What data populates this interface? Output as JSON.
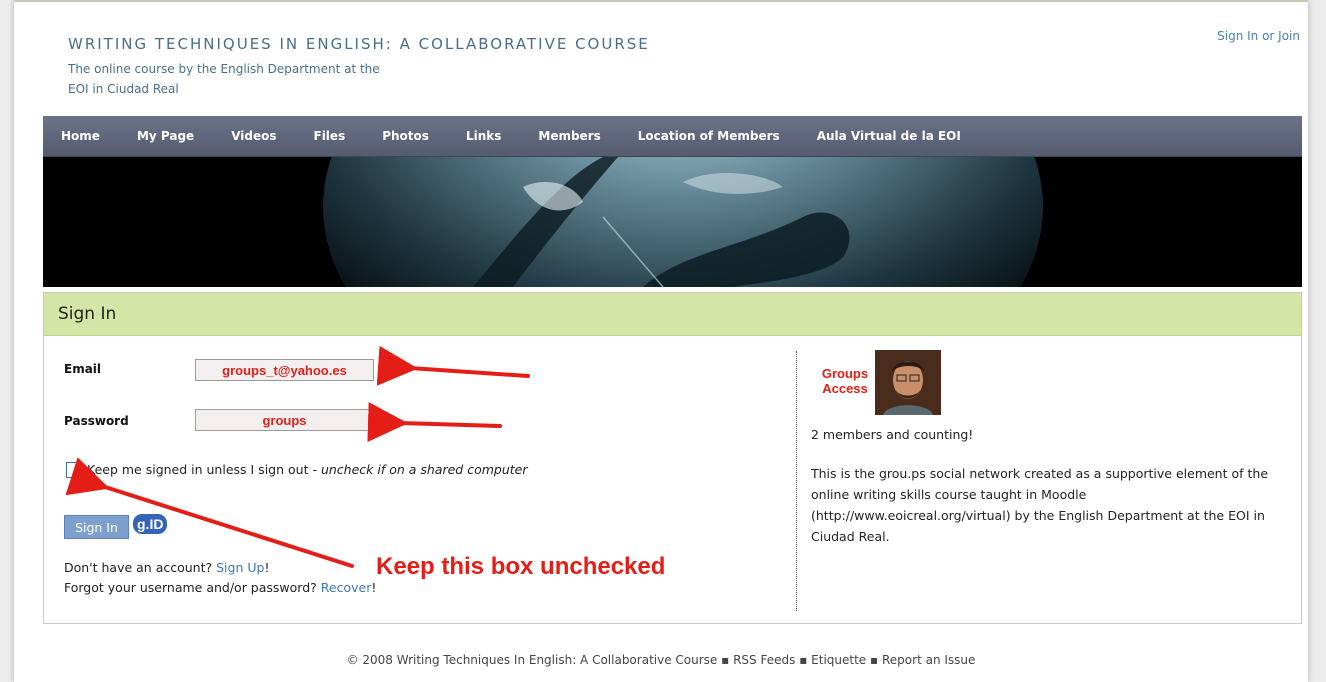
{
  "header": {
    "title": "WRITING TECHNIQUES IN ENGLISH: A COLLABORATIVE COURSE",
    "subtitle_line1": "The online course by the English Department at the",
    "subtitle_line2": "EOI in Ciudad Real",
    "account_link": "Sign In or Join"
  },
  "nav": {
    "items": [
      {
        "label": "Home"
      },
      {
        "label": "My Page"
      },
      {
        "label": "Videos"
      },
      {
        "label": "Files"
      },
      {
        "label": "Photos"
      },
      {
        "label": "Links"
      },
      {
        "label": "Members"
      },
      {
        "label": "Location of Members"
      },
      {
        "label": "Aula Virtual de la EOI"
      }
    ]
  },
  "signin": {
    "heading": "Sign In",
    "email_label": "Email",
    "email_value": "groups_t@yahoo.es",
    "password_label": "Password",
    "password_value": "groups",
    "keep_signed_text": "Keep me signed in unless I sign out - ",
    "keep_signed_hint": "uncheck if on a shared computer",
    "keep_signed_checked": false,
    "button_label": "Sign In",
    "gid_label": "g.ID",
    "no_account_text": "Don't have an account? ",
    "signup_link": "Sign Up",
    "forgot_text": "Forgot your username and/or password? ",
    "recover_link": "Recover",
    "annotation": "Keep this box unchecked",
    "annotation_color": "#e51d17"
  },
  "sidebar": {
    "group_label_line1": "Groups",
    "group_label_line2": "Access",
    "member_count": "2 members and counting!",
    "description": "This is the grou.ps social network created as a supportive element of the online writing skills course taught in Moodle (http://www.eoicreal.org/virtual) by the English Department at the EOI in Ciudad Real."
  },
  "footer": {
    "copyright": "© 2008 Writing Techniques In English: A Collaborative Course",
    "links": [
      "RSS Feeds",
      "Etiquette",
      "Report an Issue"
    ],
    "separator": "▪"
  },
  "colors": {
    "nav_bg": "#5f667b",
    "panel_head_bg": "#d4e6a5",
    "title_blue": "#4a6e8a",
    "link_blue": "#3c77b8",
    "arrow_red": "#e51d17"
  },
  "icons": {
    "banner": "globe-banner-image",
    "avatar": "member-avatar-photo"
  }
}
